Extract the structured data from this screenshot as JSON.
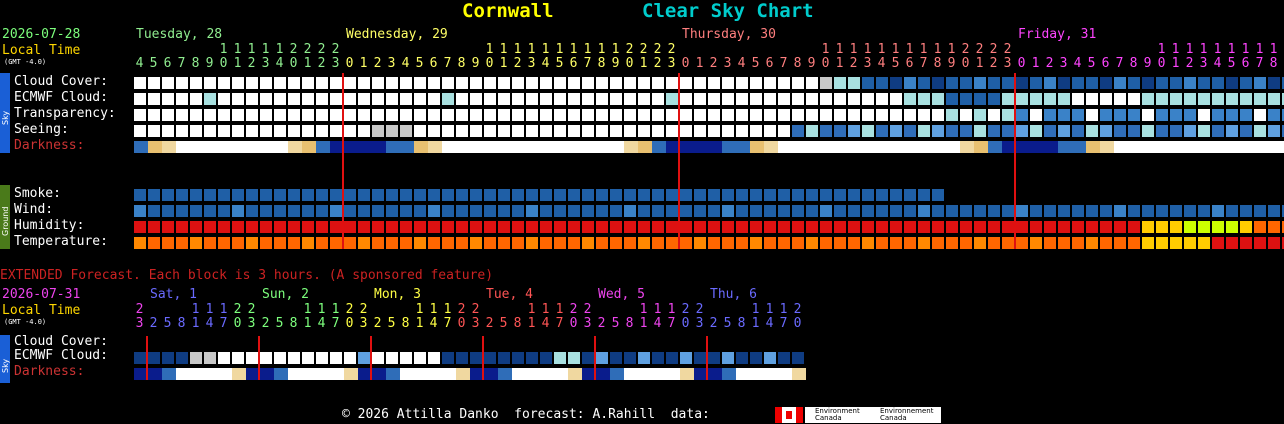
{
  "header": {
    "title": "Cornwall",
    "subtitle": "Clear Sky Chart"
  },
  "colors": {
    "date": "#7dff7d",
    "local_time": "#ffd700",
    "gmt": "#ffffff",
    "day_tue": "#90ee90",
    "day_wed": "#ffff66",
    "day_thu": "#ff7f7f",
    "day_fri": "#ff44ff",
    "line": "#e01010"
  },
  "main": {
    "date": "2026-07-28",
    "local_time_label": "Local Time",
    "gmt_offset": "(GMT -4.0)",
    "days": [
      {
        "label": "Tuesday, 28",
        "color": "#90ee90"
      },
      {
        "label": "Wednesday, 29",
        "color": "#ffff66"
      },
      {
        "label": "Thursday, 30",
        "color": "#ff7f7f"
      },
      {
        "label": "Friday, 31",
        "color": "#ff44ff"
      }
    ],
    "hours": [
      {
        "h": "4",
        "c": 0
      },
      {
        "h": "5",
        "c": 0
      },
      {
        "h": "6",
        "c": 0
      },
      {
        "h": "7",
        "c": 0
      },
      {
        "h": "8",
        "c": 0
      },
      {
        "h": "9",
        "c": 0
      },
      {
        "h": "10",
        "c": 0
      },
      {
        "h": "11",
        "c": 0
      },
      {
        "h": "12",
        "c": 0
      },
      {
        "h": "13",
        "c": 0
      },
      {
        "h": "14",
        "c": 0
      },
      {
        "h": "20",
        "c": 0
      },
      {
        "h": "21",
        "c": 0
      },
      {
        "h": "22",
        "c": 0
      },
      {
        "h": "23",
        "c": 0
      },
      {
        "h": "0",
        "c": 1
      },
      {
        "h": "1",
        "c": 1
      },
      {
        "h": "2",
        "c": 1
      },
      {
        "h": "3",
        "c": 1
      },
      {
        "h": "4",
        "c": 1
      },
      {
        "h": "5",
        "c": 1
      },
      {
        "h": "6",
        "c": 1
      },
      {
        "h": "7",
        "c": 1
      },
      {
        "h": "8",
        "c": 1
      },
      {
        "h": "9",
        "c": 1
      },
      {
        "h": "10",
        "c": 1
      },
      {
        "h": "11",
        "c": 1
      },
      {
        "h": "12",
        "c": 1
      },
      {
        "h": "13",
        "c": 1
      },
      {
        "h": "14",
        "c": 1
      },
      {
        "h": "15",
        "c": 1
      },
      {
        "h": "16",
        "c": 1
      },
      {
        "h": "17",
        "c": 1
      },
      {
        "h": "18",
        "c": 1
      },
      {
        "h": "19",
        "c": 1
      },
      {
        "h": "20",
        "c": 1
      },
      {
        "h": "21",
        "c": 1
      },
      {
        "h": "22",
        "c": 1
      },
      {
        "h": "23",
        "c": 1
      },
      {
        "h": "0",
        "c": 2
      },
      {
        "h": "1",
        "c": 2
      },
      {
        "h": "2",
        "c": 2
      },
      {
        "h": "3",
        "c": 2
      },
      {
        "h": "4",
        "c": 2
      },
      {
        "h": "5",
        "c": 2
      },
      {
        "h": "6",
        "c": 2
      },
      {
        "h": "7",
        "c": 2
      },
      {
        "h": "8",
        "c": 2
      },
      {
        "h": "9",
        "c": 2
      },
      {
        "h": "10",
        "c": 2
      },
      {
        "h": "11",
        "c": 2
      },
      {
        "h": "12",
        "c": 2
      },
      {
        "h": "13",
        "c": 2
      },
      {
        "h": "14",
        "c": 2
      },
      {
        "h": "15",
        "c": 2
      },
      {
        "h": "16",
        "c": 2
      },
      {
        "h": "17",
        "c": 2
      },
      {
        "h": "18",
        "c": 2
      },
      {
        "h": "19",
        "c": 2
      },
      {
        "h": "20",
        "c": 2
      },
      {
        "h": "21",
        "c": 2
      },
      {
        "h": "22",
        "c": 2
      },
      {
        "h": "23",
        "c": 2
      },
      {
        "h": "0",
        "c": 3
      },
      {
        "h": "1",
        "c": 3
      },
      {
        "h": "2",
        "c": 3
      },
      {
        "h": "3",
        "c": 3
      },
      {
        "h": "4",
        "c": 3
      },
      {
        "h": "5",
        "c": 3
      },
      {
        "h": "6",
        "c": 3
      },
      {
        "h": "7",
        "c": 3
      },
      {
        "h": "8",
        "c": 3
      },
      {
        "h": "9",
        "c": 3
      },
      {
        "h": "10",
        "c": 3
      },
      {
        "h": "11",
        "c": 3
      },
      {
        "h": "12",
        "c": 3
      },
      {
        "h": "13",
        "c": 3
      },
      {
        "h": "14",
        "c": 3
      },
      {
        "h": "15",
        "c": 3
      },
      {
        "h": "16",
        "c": 3
      },
      {
        "h": "17",
        "c": 3
      },
      {
        "h": "18",
        "c": 3
      },
      {
        "h": "19",
        "c": 3
      },
      {
        "h": "20",
        "c": 3
      }
    ],
    "sky_side_label": "Sky",
    "ground_side_label": "Ground",
    "sky_rows": [
      {
        "label": "Cloud Cover:",
        "type": "cloud",
        "cells": [
          "w",
          "w",
          "w",
          "w",
          "w",
          "w",
          "w",
          "w",
          "w",
          "w",
          "w",
          "w",
          "w",
          "w",
          "w",
          "w",
          "w",
          "w",
          "w",
          "w",
          "w",
          "w",
          "w",
          "w",
          "w",
          "w",
          "w",
          "w",
          "w",
          "w",
          "w",
          "w",
          "w",
          "w",
          "w",
          "w",
          "w",
          "w",
          "w",
          "w",
          "w",
          "w",
          "w",
          "w",
          "w",
          "w",
          "w",
          "w",
          "w",
          "w",
          "w",
          "w",
          "w",
          "w",
          "w",
          "w",
          "w",
          "w",
          "w",
          "w",
          "w",
          "w",
          "w",
          "w",
          "w",
          "w",
          "w",
          "w",
          "w",
          "w",
          "w",
          "w",
          "w",
          "w",
          "w",
          "w",
          "w",
          "w",
          "w",
          "w",
          "w",
          "w",
          "w",
          "w",
          "w",
          "w",
          "w",
          "w",
          "w",
          "w",
          "w",
          "w",
          "w",
          "w",
          "w",
          "w",
          "w",
          "w",
          "w",
          "w",
          "w",
          "w",
          "w",
          "w",
          "w",
          "w",
          "w",
          "w",
          "w",
          "w",
          "w",
          "w",
          "w",
          "w",
          "w",
          "w",
          "w",
          "w",
          "w",
          "w",
          "w",
          "w",
          "w",
          "w",
          "w",
          "w",
          "w",
          "w",
          "w",
          "w",
          "w",
          "w",
          "w",
          "w",
          "w",
          "w"
        ]
      },
      {
        "label": "ECMWF Cloud:",
        "type": "cloud"
      },
      {
        "label": "Transparency:",
        "type": "cloud"
      },
      {
        "label": "Seeing:",
        "type": "seeing"
      },
      {
        "label": "Darkness:",
        "type": "dark",
        "color": "#cc3333"
      }
    ],
    "ground_rows": [
      {
        "label": "Smoke:"
      },
      {
        "label": "Wind:"
      },
      {
        "label": "Humidity:"
      },
      {
        "label": "Temperature:"
      }
    ]
  },
  "extended": {
    "heading": "EXTENDED Forecast. Each block is 3 hours. (A sponsored feature)",
    "date": "2026-07-31",
    "local_time_label": "Local Time",
    "gmt_offset": "(GMT -4.0)",
    "days": [
      {
        "label": "Sat, 1",
        "color": "#6a6aff"
      },
      {
        "label": "Sun, 2",
        "color": "#7dff7d"
      },
      {
        "label": "Mon, 3",
        "color": "#ffff44"
      },
      {
        "label": "Tue, 4",
        "color": "#ff5555"
      },
      {
        "label": "Wed, 5",
        "color": "#ee44ee"
      },
      {
        "label": "Thu, 6",
        "color": "#6a6aff"
      }
    ],
    "hours": [
      "23",
      "2",
      "5",
      "8",
      "11",
      "14",
      "17",
      "20",
      "23",
      "2",
      "5",
      "8",
      "11",
      "14",
      "17",
      "20",
      "23",
      "2",
      "5",
      "8",
      "11",
      "14",
      "17",
      "20",
      "23",
      "2",
      "5",
      "8",
      "11",
      "14",
      "17",
      "20",
      "23",
      "2",
      "5",
      "8",
      "11",
      "14",
      "17",
      "20",
      "23",
      "2",
      "5",
      "8",
      "11",
      "14",
      "17",
      "20",
      "23",
      "2",
      "5",
      "8",
      "11",
      "14",
      "17",
      "20",
      "23",
      "2",
      "5",
      "8",
      "11",
      "14",
      "17",
      "20",
      "23",
      "2",
      "5",
      "8",
      "11",
      "14",
      "17",
      "20"
    ],
    "rows": [
      {
        "label": "Cloud Cover:"
      },
      {
        "label": "ECMWF Cloud:"
      },
      {
        "label": "Darkness:"
      }
    ]
  },
  "footer": {
    "text": "© 2026 Attilla Danko  forecast: A.Rahill  data:",
    "logo_text_1": "Environment Canada",
    "logo_text_2": "Environnement Canada"
  }
}
